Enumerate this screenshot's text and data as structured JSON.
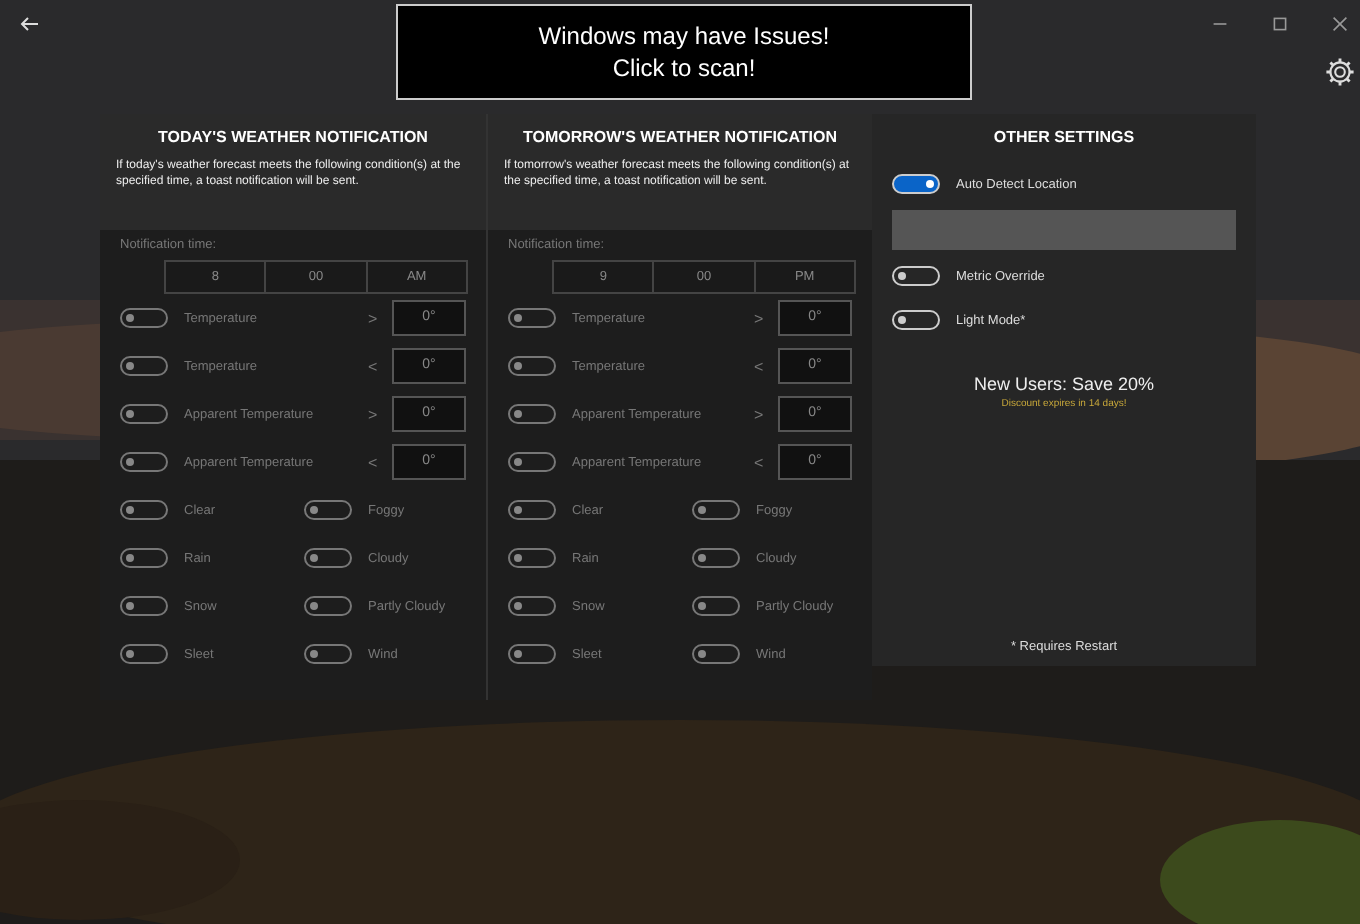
{
  "banner": {
    "lines": [
      "Windows may have Issues!",
      "Click to scan!"
    ]
  },
  "panels": [
    {
      "title": "TODAY'S WEATHER NOTIFICATION",
      "description": "If today's weather forecast meets the following condition(s) at the specified time, a toast notification will be sent.",
      "time_label": "Notification time:",
      "time": [
        "8",
        "00",
        "AM"
      ],
      "comparisons": [
        {
          "label": "Temperature",
          "operator": ">",
          "value": "0°",
          "on": false
        },
        {
          "label": "Temperature",
          "operator": "<",
          "value": "0°",
          "on": false
        },
        {
          "label": "Apparent Temperature",
          "operator": ">",
          "value": "0°",
          "on": false
        },
        {
          "label": "Apparent Temperature",
          "operator": "<",
          "value": "0°",
          "on": false
        }
      ],
      "conditions": [
        {
          "label": "Clear",
          "on": false
        },
        {
          "label": "Foggy",
          "on": false
        },
        {
          "label": "Rain",
          "on": false
        },
        {
          "label": "Cloudy",
          "on": false
        },
        {
          "label": "Snow",
          "on": false
        },
        {
          "label": "Partly Cloudy",
          "on": false
        },
        {
          "label": "Sleet",
          "on": false
        },
        {
          "label": "Wind",
          "on": false
        }
      ]
    },
    {
      "title": "TOMORROW'S WEATHER NOTIFICATION",
      "description": "If tomorrow's weather forecast meets the following condition(s) at the specified time, a toast notification will be sent.",
      "time_label": "Notification time:",
      "time": [
        "9",
        "00",
        "PM"
      ],
      "comparisons": [
        {
          "label": "Temperature",
          "operator": ">",
          "value": "0°",
          "on": false
        },
        {
          "label": "Temperature",
          "operator": "<",
          "value": "0°",
          "on": false
        },
        {
          "label": "Apparent Temperature",
          "operator": ">",
          "value": "0°",
          "on": false
        },
        {
          "label": "Apparent Temperature",
          "operator": "<",
          "value": "0°",
          "on": false
        }
      ],
      "conditions": [
        {
          "label": "Clear",
          "on": false
        },
        {
          "label": "Foggy",
          "on": false
        },
        {
          "label": "Rain",
          "on": false
        },
        {
          "label": "Cloudy",
          "on": false
        },
        {
          "label": "Snow",
          "on": false
        },
        {
          "label": "Partly Cloudy",
          "on": false
        },
        {
          "label": "Sleet",
          "on": false
        },
        {
          "label": "Wind",
          "on": false
        }
      ]
    }
  ],
  "other_settings": {
    "title": "OTHER SETTINGS",
    "items": [
      {
        "kind": "toggle",
        "label": "Auto Detect Location",
        "on": true
      },
      {
        "kind": "field"
      },
      {
        "kind": "toggle",
        "label": "Metric Override",
        "on": false
      },
      {
        "kind": "toggle",
        "label": "Light Mode*",
        "on": false
      }
    ],
    "promo": {
      "title": "New Users: Save 20%",
      "note": "Discount expires in 14 days!"
    },
    "footnote": "* Requires Restart"
  }
}
